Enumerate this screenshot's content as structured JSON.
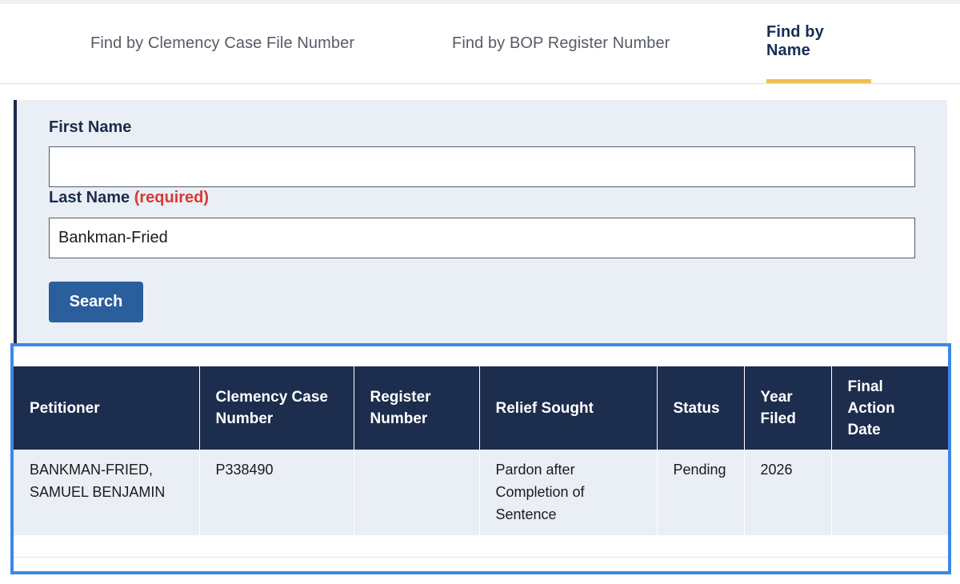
{
  "tabs": [
    {
      "label": "Find by Clemency Case File Number",
      "active": false
    },
    {
      "label": "Find by BOP Register Number",
      "active": false
    },
    {
      "label": "Find by Name",
      "active": true
    }
  ],
  "form": {
    "first_name_label": "First Name",
    "first_name_value": "",
    "last_name_label": "Last Name",
    "required_text": "(required)",
    "last_name_value": "Bankman-Fried",
    "search_label": "Search"
  },
  "results": {
    "columns": [
      "Petitioner",
      "Clemency Case Number",
      "Register Number",
      "Relief Sought",
      "Status",
      "Year Filed",
      "Final Action Date"
    ],
    "rows": [
      {
        "petitioner": "BANKMAN-FRIED, SAMUEL BENJAMIN",
        "case_number": "P338490",
        "register_number": "",
        "relief_sought": "Pardon after Completion of Sentence",
        "status": "Pending",
        "year_filed": "2026",
        "final_action_date": ""
      }
    ]
  },
  "colors": {
    "header_navy": "#1c2d4d",
    "button_blue": "#2a5e9c",
    "active_tab_underline": "#f2be55",
    "required_red": "#d83933",
    "highlight_frame": "#3d86e8"
  }
}
